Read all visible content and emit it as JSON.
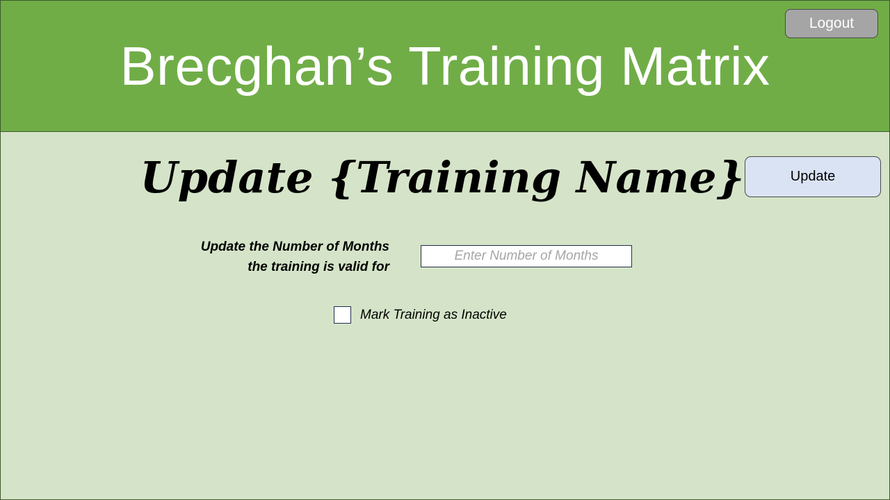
{
  "header": {
    "title": "Brecghan’s Training Matrix",
    "logout_label": "Logout",
    "background_color": "#70ad47"
  },
  "main": {
    "heading": "Update {Training Name}",
    "update_label": "Update",
    "months_label_line1": "Update the Number of Months",
    "months_label_line2": "the training is valid for",
    "months_input_value": "",
    "months_input_placeholder": "Enter Number of Months",
    "inactive_label": "Mark Training as Inactive",
    "inactive_checked": false,
    "background_color": "#d5e4c8"
  },
  "colors": {
    "logout_button": "#a5a5a5",
    "update_button": "#dae3f3"
  }
}
